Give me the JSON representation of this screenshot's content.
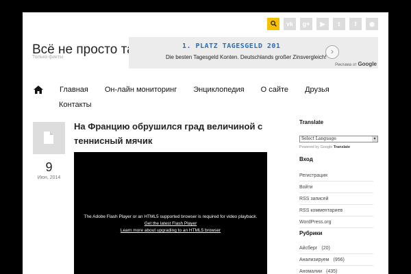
{
  "site": {
    "title": "Всё не просто так",
    "tagline": "Только факты"
  },
  "social": [
    {
      "icon": "search-icon",
      "glyph": "🔍",
      "color": "#f6c000"
    },
    {
      "icon": "vk-icon",
      "glyph": "vk"
    },
    {
      "icon": "google-plus-icon",
      "glyph": "g+"
    },
    {
      "icon": "youtube-icon",
      "glyph": "▶"
    },
    {
      "icon": "twitter-icon",
      "glyph": "t"
    },
    {
      "icon": "facebook-icon",
      "glyph": "f"
    },
    {
      "icon": "rss-icon",
      "glyph": "◉"
    }
  ],
  "ad": {
    "headline": "1. PLATZ TAGESGELD 201",
    "text": "Die besten Tagesgeld Konten. Deutschlands großer Zinsvergleich!",
    "label": "Реклама от",
    "brand": "Google"
  },
  "nav": {
    "items": [
      "Главная",
      "Он-лайн мониторинг",
      "Энциклопедия",
      "О сайте",
      "Друзья",
      "Контакты"
    ]
  },
  "post": {
    "day": "9",
    "month": "Июн, 2014",
    "title": "На Францию обрушился град величиной с теннисный мячик",
    "video_line1": "The Adobe Flash Player or an HTML5 supported browser is required for video playback.",
    "video_link1": "Get the latest Flash Player",
    "video_link2": "Learn more about upgrading to an HTML5 browser"
  },
  "sidebar": {
    "translate_title": "Translate",
    "language_select": "Select Language",
    "powered_by": "Powered by",
    "powered_brand": "Google",
    "powered_translate": "Translate",
    "login_title": "Вход",
    "login_links": [
      "Регистрация",
      "Войти",
      "RSS записей",
      "RSS комментариев",
      "WordPress.org"
    ],
    "rubrics_title": "Рубрики",
    "rubrics": [
      {
        "name": "Айсберг",
        "count": "(20)"
      },
      {
        "name": "Анализируем",
        "count": "(956)"
      },
      {
        "name": "Аномалии",
        "count": "(435)"
      }
    ]
  }
}
